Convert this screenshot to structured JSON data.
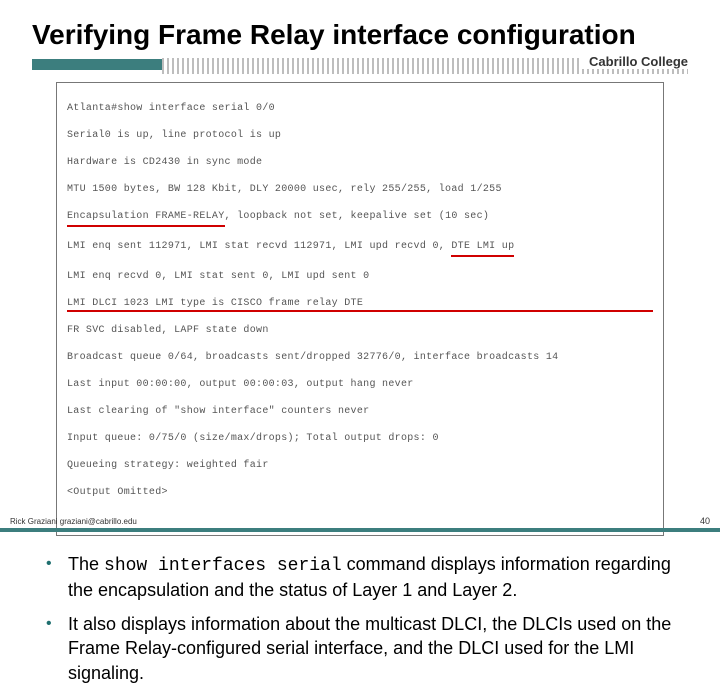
{
  "title": "Verifying Frame Relay interface configuration",
  "brand": "Cabrillo College",
  "terminal": {
    "l1": "Atlanta#show interface serial 0/0",
    "l2": "Serial0 is up, line protocol is up",
    "l3": "Hardware is CD2430 in sync mode",
    "l4": "MTU 1500 bytes, BW 128 Kbit, DLY 20000 usec, rely 255/255, load 1/255",
    "l5a": "Encapsulation FRAME-RELAY",
    "l5b": ", loopback not set, keepalive set (10 sec)",
    "l6a": "LMI enq sent 112971, LMI stat recvd 112971, LMI upd recvd 0, ",
    "l6b": "DTE LMI up",
    "l7": "LMI enq recvd 0, LMI stat sent 0, LMI upd sent 0",
    "l8": "LMI DLCI 1023 LMI type is CISCO frame relay DTE",
    "l9": "FR SVC disabled, LAPF state down",
    "l10": "Broadcast queue 0/64, broadcasts sent/dropped 32776/0, interface broadcasts 14",
    "l11": "Last input 00:00:00, output 00:00:03, output hang never",
    "l12": "Last clearing of \"show interface\" counters never",
    "l13": "Input queue: 0/75/0 (size/max/drops); Total output drops: 0",
    "l14": "Queueing strategy: weighted fair",
    "l15": "<Output Omitted>"
  },
  "bullets": {
    "b1_pre": "The ",
    "b1_cmd": "show interfaces serial",
    "b1_post": " command displays information regarding the encapsulation and the status of Layer 1 and Layer 2.",
    "b2": "It also displays information about the multicast DLCI, the DLCIs used on the Frame Relay-configured serial interface, and the DLCI used for the LMI signaling."
  },
  "footer": {
    "credit": "Rick Graziani  graziani@cabrillo.edu",
    "page": "40"
  }
}
